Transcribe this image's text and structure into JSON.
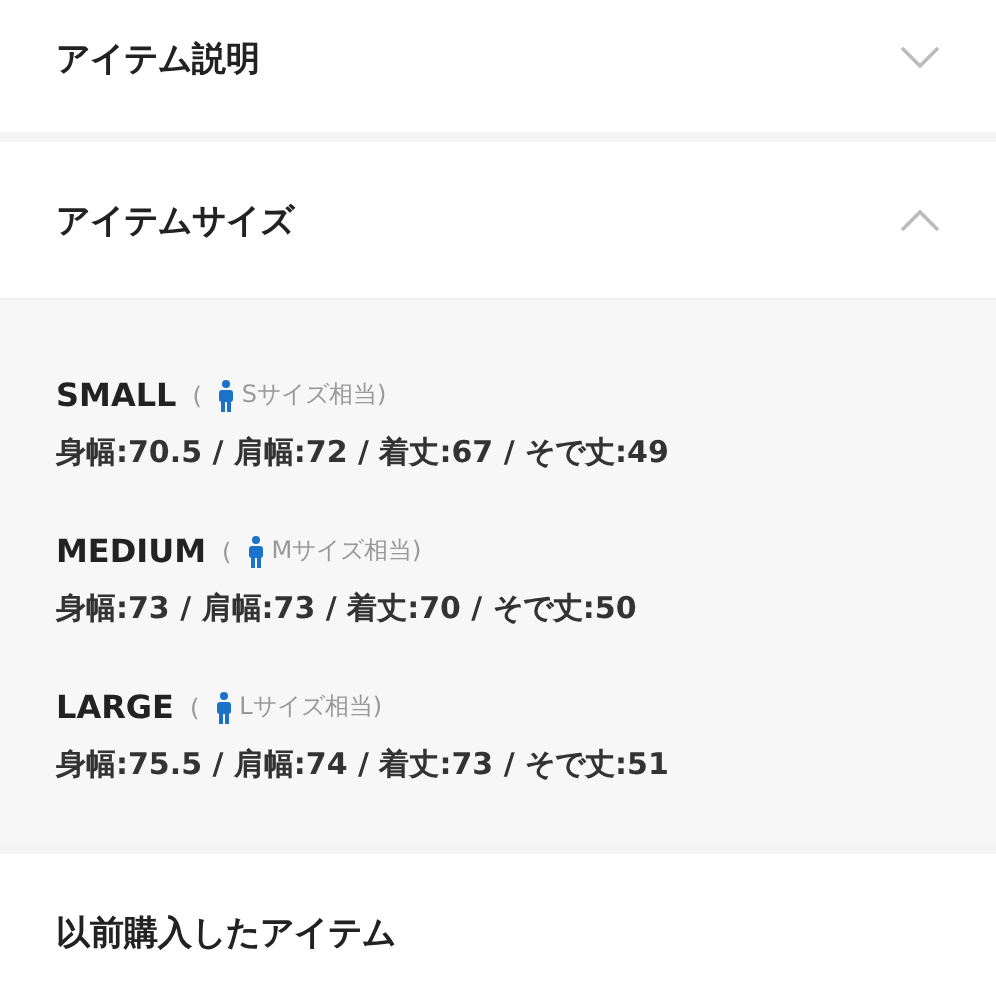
{
  "sections": [
    {
      "title": "アイテム説明",
      "expanded": false
    },
    {
      "title": "アイテムサイズ",
      "expanded": true,
      "sizes": [
        {
          "name": "SMALL",
          "note_open": "(",
          "note": "Sサイズ相当)",
          "spec": "身幅:70.5 / 肩幅:72 / 着丈:67 / そで丈:49"
        },
        {
          "name": "MEDIUM",
          "note_open": "(",
          "note": "Mサイズ相当)",
          "spec": "身幅:73 / 肩幅:73 / 着丈:70 / そで丈:50"
        },
        {
          "name": "LARGE",
          "note_open": "(",
          "note": "Lサイズ相当)",
          "spec": "身幅:75.5 / 肩幅:74 / 着丈:73 / そで丈:51"
        }
      ]
    },
    {
      "title": "以前購入したアイテム"
    }
  ]
}
